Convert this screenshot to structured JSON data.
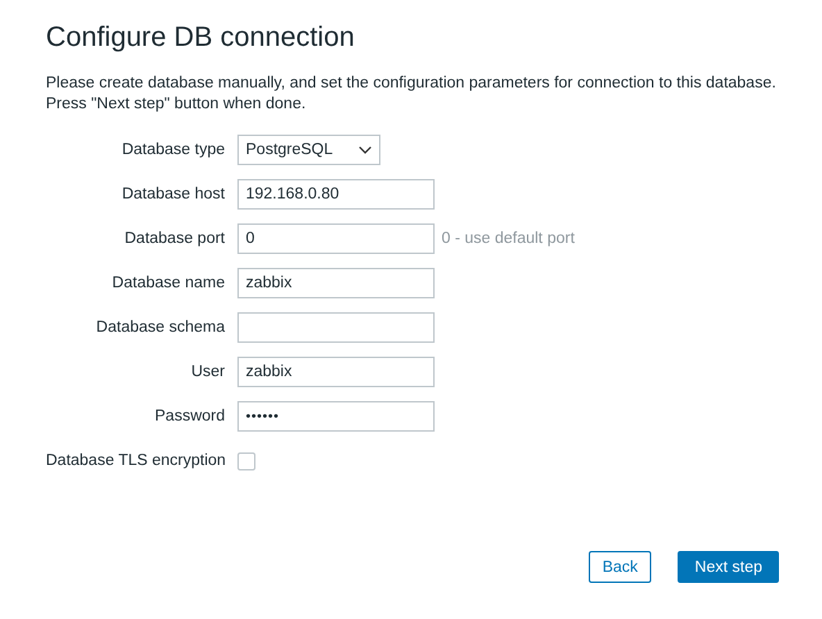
{
  "title": "Configure DB connection",
  "description": [
    "Please create database manually, and set the configuration parameters for connection to this database.",
    "Press \"Next step\" button when done."
  ],
  "fields": [
    {
      "kind": "select",
      "label": "Database type",
      "value": "PostgreSQL"
    },
    {
      "kind": "text",
      "label": "Database host",
      "value": "192.168.0.80"
    },
    {
      "kind": "text",
      "label": "Database port",
      "value": "0",
      "hint": "0 - use default port"
    },
    {
      "kind": "text",
      "label": "Database name",
      "value": "zabbix"
    },
    {
      "kind": "text",
      "label": "Database schema"
    },
    {
      "kind": "text",
      "label": "User",
      "value": "zabbix"
    },
    {
      "kind": "password",
      "label": "Password",
      "value": "••••••"
    },
    {
      "kind": "checkbox",
      "label": "Database TLS encryption",
      "checked": false
    }
  ],
  "buttons": [
    {
      "label": "Back",
      "kind": "secondary"
    },
    {
      "label": "Next step",
      "kind": "primary"
    }
  ]
}
